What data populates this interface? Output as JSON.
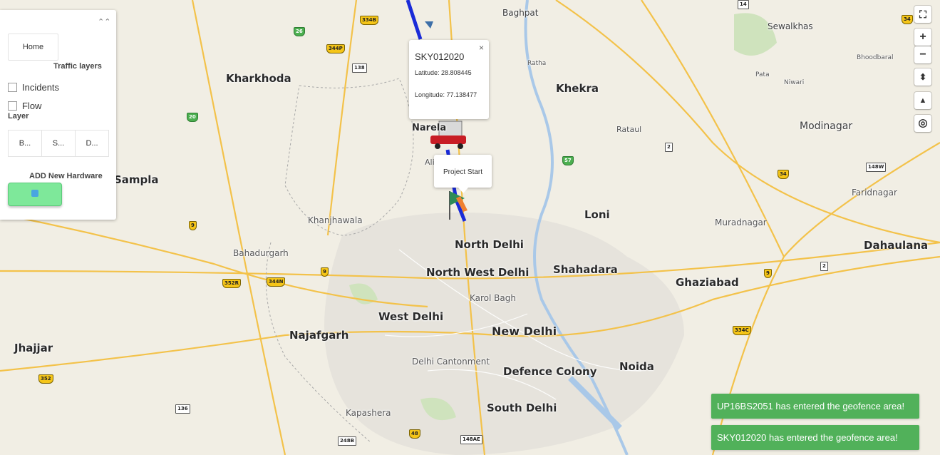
{
  "map": {
    "places_major": [
      {
        "name": "Kharkhoda"
      },
      {
        "name": "Khekra"
      },
      {
        "name": "Sampla"
      },
      {
        "name": "Loni"
      },
      {
        "name": "North Delhi"
      },
      {
        "name": "North West Delhi"
      },
      {
        "name": "Shahadara"
      },
      {
        "name": "Ghaziabad"
      },
      {
        "name": "Dahaulana"
      },
      {
        "name": "West Delhi"
      },
      {
        "name": "New Delhi"
      },
      {
        "name": "Najafgarh"
      },
      {
        "name": "Jhajjar"
      },
      {
        "name": "Defence Colony"
      },
      {
        "name": "Noida"
      },
      {
        "name": "South Delhi"
      },
      {
        "name": "Modinagar"
      }
    ],
    "places_minor": [
      {
        "name": "Baghpat"
      },
      {
        "name": "Sewalkhas"
      },
      {
        "name": "Bhoodbaral"
      },
      {
        "name": "Pata"
      },
      {
        "name": "Niwari"
      },
      {
        "name": "Ratha"
      },
      {
        "name": "Rataul"
      },
      {
        "name": "Faridnagar"
      },
      {
        "name": "Khanjhawala"
      },
      {
        "name": "Bahadurgarh"
      },
      {
        "name": "Muradnagar"
      },
      {
        "name": "Karol Bagh"
      },
      {
        "name": "Delhi Cantonment"
      },
      {
        "name": "Kapashera"
      },
      {
        "name": "Narela"
      },
      {
        "name": "Alipur"
      }
    ],
    "shields": [
      "14",
      "334B",
      "26",
      "344P",
      "138",
      "20",
      "57",
      "2",
      "34",
      "148W",
      "9",
      "352R",
      "344N",
      "9",
      "9",
      "2",
      "334C",
      "352",
      "136",
      "248B",
      "48",
      "148AE",
      "34"
    ]
  },
  "panel": {
    "home_label": "Home",
    "traffic_title": "Traffic layers",
    "incidents_label": "Incidents",
    "flow_label": "Flow",
    "layer_title": "Layer",
    "layer_buttons": [
      "B...",
      "S...",
      "D..."
    ],
    "add_title": "ADD New Hardware"
  },
  "popup_vehicle": {
    "title": "SKY012020",
    "latitude": "Latitude: 28.808445",
    "longitude": "Longitude: 77.138477",
    "close": "×"
  },
  "popup_start": {
    "text": "Project Start"
  },
  "controls": {
    "zoom_in": "+",
    "zoom_out": "−",
    "fullscreen": "⛶",
    "compass": "⬍",
    "tilt": "▲",
    "locate": "◎"
  },
  "toasts": [
    "UP16BS2051 has entered the geofence area!",
    "SKY012020 has entered the geofence area!"
  ],
  "colors": {
    "route": "#1a2bd8",
    "toast": "#51b15a",
    "add_button": "#7ee89a"
  }
}
